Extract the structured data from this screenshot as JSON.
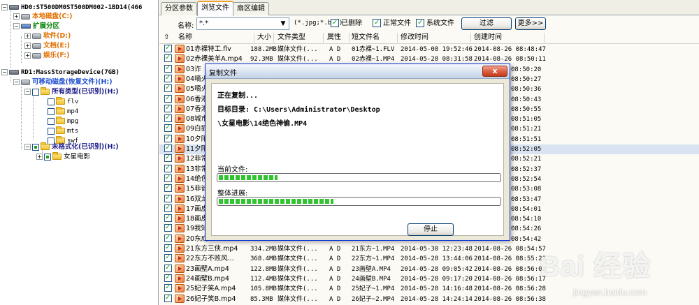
{
  "tree": {
    "disk0": "HD0:ST500DM0ST500DM002-1BD14(466",
    "local_disk": "本地磁盘(C:)",
    "ext_partition": "扩展分区",
    "soft": "软件(D:)",
    "docs": "文档(E:)",
    "ent": "娱乐(F:)",
    "disk1": "RD1:MassStorageDevice(7GB)",
    "removable": "可移动磁盘(恢复文件)(H:)",
    "all_types": "所有类型(已识别)(H:)",
    "types": [
      "flv",
      "mp4",
      "mpg",
      "mts",
      "swf"
    ],
    "unformatted": "未格式化(已识别)(H:)",
    "star_folder": "女星电影"
  },
  "tabs": [
    "分区参数",
    "浏览文件",
    "扇区编辑"
  ],
  "filter": {
    "name_label": "名称:",
    "name_value": "*.*",
    "hint": "(*.jpg;*.bmp)",
    "deleted": "已删除",
    "normal": "正常文件",
    "system": "系统文件",
    "filter_btn": "过滤",
    "more_btn": "更多>>"
  },
  "columns": [
    "名称",
    "大小",
    "文件类型",
    "属性",
    "短文件名",
    "修改时间",
    "创建时间"
  ],
  "rows": [
    {
      "name": "01赤裸特工.flv",
      "size": "188.2MB",
      "type": "媒体文件(...",
      "attr": "A D",
      "short": "01赤裸~1.FLV",
      "mtime": "2014-05-08 19:52:46",
      "ctime": "2014-08-26 08:48:47"
    },
    {
      "name": "02赤裸美羊A.mp4",
      "size": "92.3MB",
      "type": "媒体文件(...",
      "attr": "A D",
      "short": "02赤裸~1.MP4",
      "mtime": "2014-05-28 08:31:58",
      "ctime": "2014-08-26 08:50:11"
    },
    {
      "name": "03诈",
      "ctime": "08:50:20"
    },
    {
      "name": "04嘀火",
      "ctime": "08:50:27"
    },
    {
      "name": "05嘀火",
      "ctime": "08:50:36"
    },
    {
      "name": "06香港",
      "ctime": "08:50:43"
    },
    {
      "name": "07香港",
      "ctime": "08:50:55"
    },
    {
      "name": "08城市",
      "ctime": "08:51:05"
    },
    {
      "name": "09白狐",
      "ctime": "08:51:21"
    },
    {
      "name": "10夕阳",
      "ctime": "08:51:51"
    },
    {
      "name": "11夕阳",
      "ctime": "08:52:05"
    },
    {
      "name": "12非常",
      "ctime": "08:52:21"
    },
    {
      "name": "13非常",
      "ctime": "08:52:37"
    },
    {
      "name": "14绝色",
      "ctime": "08:52:54"
    },
    {
      "name": "15非诚",
      "ctime": "08:53:08"
    },
    {
      "name": "16双龙",
      "ctime": "08:53:47"
    },
    {
      "name": "17画皮",
      "ctime": "08:54:01"
    },
    {
      "name": "18画皮",
      "ctime": "08:54:10"
    },
    {
      "name": "19我知",
      "ctime": "08:54:26"
    },
    {
      "name": "20东成",
      "ctime": "08:54:42"
    },
    {
      "name": "21东方三侠.mp4",
      "size": "334.2MB",
      "type": "媒体文件(...",
      "attr": "A D",
      "short": "21东方~1.MP4",
      "mtime": "2014-05-30 12:23:48",
      "ctime": "2014-08-26 08:54:57"
    },
    {
      "name": "22东方不败风...",
      "size": "368.4MB",
      "type": "媒体文件(...",
      "attr": "A D",
      "short": "22东方~1.MP4",
      "mtime": "2014-05-28 13:44:06",
      "ctime": "2014-08-26 08:55:20"
    },
    {
      "name": "23画壁A.mp4",
      "size": "122.8MB",
      "type": "媒体文件(...",
      "attr": "A D",
      "short": "23画壁A.MP4",
      "mtime": "2014-05-28 09:05:42",
      "ctime": "2014-08-26 08:56:02"
    },
    {
      "name": "24画壁B.mp4",
      "size": "112.4MB",
      "type": "媒体文件(...",
      "attr": "A D",
      "short": "24画壁B.MP4",
      "mtime": "2014-05-28 09:17:20",
      "ctime": "2014-08-26 08:56:17"
    },
    {
      "name": "25妃子笑A.mp4",
      "size": "105.8MB",
      "type": "媒体文件(...",
      "attr": "A D",
      "short": "25妃子~1.MP4",
      "mtime": "2014-05-28 14:16:48",
      "ctime": "2014-08-26 08:56:28"
    },
    {
      "name": "26妃子笑B.mp4",
      "size": "85.3MB",
      "type": "媒体文件(...",
      "attr": "A D",
      "short": "26妃子~2.MP4",
      "mtime": "2014-05-28 14:24:14",
      "ctime": "2014-08-26 08:56:38"
    }
  ],
  "dialog": {
    "title": "复制文件",
    "copying": "正在复制...",
    "target": "目标目录: C:\\Users\\Administrator\\Desktop",
    "path": "\\女星电影\\14绝色神偷.MP4",
    "current_label": "当前文件:",
    "total_label": "整体进展:",
    "current_progress": 0.21,
    "total_progress": 0.41,
    "stop_btn": "停止",
    "close_glyph": "x"
  },
  "watermark": {
    "brand": "Bai 经验",
    "url": "jingyan.baidu.com"
  }
}
